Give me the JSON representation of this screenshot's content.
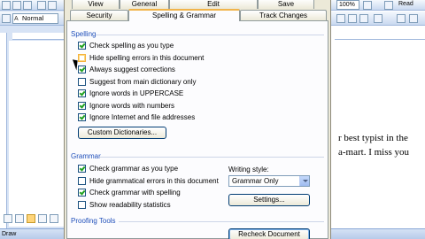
{
  "word": {
    "style_value": "Normal",
    "zoom": "100%",
    "read_label": "Read",
    "draw_label": "Draw",
    "doc_lines": [
      "r best typist in the",
      "a-mart. I miss you"
    ]
  },
  "dialog": {
    "tabs_row1": [
      "View",
      "General",
      "Edit",
      "Save"
    ],
    "tabs_row2": [
      "Security",
      "Spelling & Grammar",
      "Track Changes"
    ],
    "spelling": {
      "heading": "Spelling",
      "options": [
        {
          "label": "Check spelling as you type",
          "checked": true
        },
        {
          "label": "Hide spelling errors in this document",
          "checked": false
        },
        {
          "label": "Always suggest corrections",
          "checked": true
        },
        {
          "label": "Suggest from main dictionary only",
          "checked": false
        },
        {
          "label": "Ignore words in UPPERCASE",
          "checked": true
        },
        {
          "label": "Ignore words with numbers",
          "checked": true
        },
        {
          "label": "Ignore Internet and file addresses",
          "checked": true
        }
      ],
      "custom_dictionaries_button": "Custom Dictionaries..."
    },
    "grammar": {
      "heading": "Grammar",
      "options": [
        {
          "label": "Check grammar as you type",
          "checked": true
        },
        {
          "label": "Hide grammatical errors in this document",
          "checked": false
        },
        {
          "label": "Check grammar with spelling",
          "checked": true
        },
        {
          "label": "Show readability statistics",
          "checked": false
        }
      ],
      "writing_style_label": "Writing style:",
      "writing_style_value": "Grammar Only",
      "settings_button": "Settings..."
    },
    "proofing": {
      "heading": "Proofing Tools",
      "recheck_button": "Recheck Document"
    }
  }
}
